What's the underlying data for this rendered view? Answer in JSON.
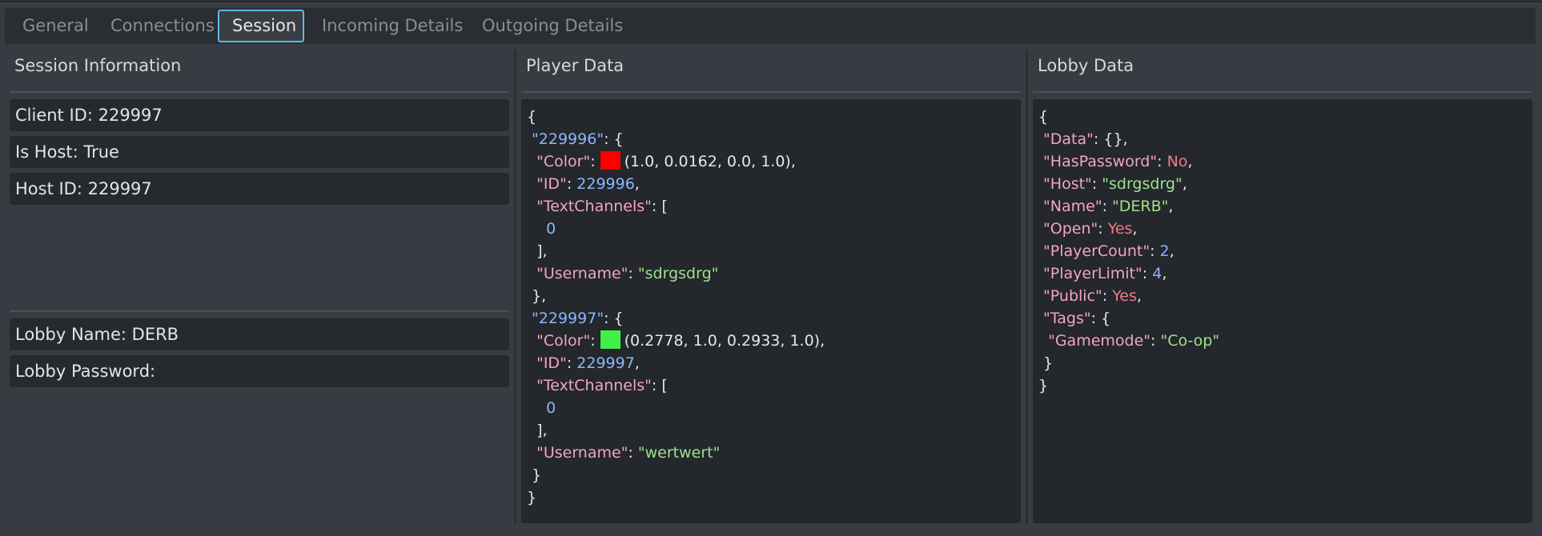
{
  "tabs": [
    {
      "label": "General",
      "active": false
    },
    {
      "label": "Connections",
      "active": false
    },
    {
      "label": "Session",
      "active": true
    },
    {
      "label": "Incoming Details",
      "active": false
    },
    {
      "label": "Outgoing Details",
      "active": false
    }
  ],
  "session": {
    "title": "Session Information",
    "client_id": {
      "label": "Client ID: ",
      "value": "229997"
    },
    "is_host": {
      "label": "Is Host: ",
      "value": "True"
    },
    "host_id": {
      "label": "Host ID: ",
      "value": "229997"
    },
    "lobby_name": {
      "label": "Lobby Name: ",
      "value": "DERB"
    },
    "lobby_password": {
      "label": "Lobby Password: ",
      "value": ""
    }
  },
  "player_data": {
    "title": "Player Data",
    "players": [
      {
        "key": "\"229996\"",
        "color_label": "\"Color\"",
        "color_hex": "#ff0000",
        "color_value": "(1.0, 0.0162, 0.0, 1.0)",
        "id_label": "\"ID\"",
        "id_value": "229996",
        "channels_label": "\"TextChannels\"",
        "channel_0": "0",
        "username_label": "\"Username\"",
        "username_value": "\"sdrgsdrg\""
      },
      {
        "key": "\"229997\"",
        "color_label": "\"Color\"",
        "color_hex": "#3ff046",
        "color_value": "(0.2778, 1.0, 0.2933, 1.0)",
        "id_label": "\"ID\"",
        "id_value": "229997",
        "channels_label": "\"TextChannels\"",
        "channel_0": "0",
        "username_label": "\"Username\"",
        "username_value": "\"wertwert\""
      }
    ]
  },
  "lobby_data": {
    "title": "Lobby Data",
    "fields": {
      "data_label": "\"Data\"",
      "data_value": "{}",
      "haspassword_label": "\"HasPassword\"",
      "haspassword_value": "No",
      "host_label": "\"Host\"",
      "host_value": "\"sdrgsdrg\"",
      "name_label": "\"Name\"",
      "name_value": "\"DERB\"",
      "open_label": "\"Open\"",
      "open_value": "Yes",
      "playercount_label": "\"PlayerCount\"",
      "playercount_value": "2",
      "playerlimit_label": "\"PlayerLimit\"",
      "playerlimit_value": "4",
      "public_label": "\"Public\"",
      "public_value": "Yes",
      "tags_label": "\"Tags\"",
      "gamemode_label": "\"Gamemode\"",
      "gamemode_value": "\"Co-op\""
    }
  },
  "colors": {
    "accent": "#5fb8e8",
    "key": "#f2a3c9",
    "string": "#9fe28d",
    "number": "#8bb6ff",
    "boolean": "#f07a8b"
  }
}
